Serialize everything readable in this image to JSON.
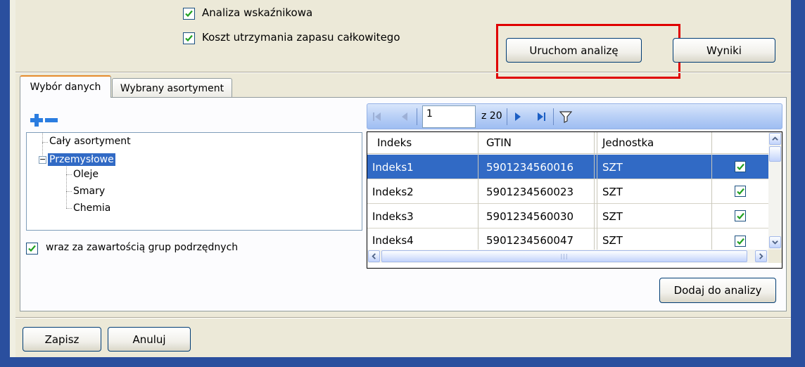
{
  "options": {
    "ratio_analysis": {
      "label": "Analiza wskaźnikowa",
      "checked": true
    },
    "inventory_cost": {
      "label": "Koszt utrzymania zapasu całkowitego",
      "checked": true
    }
  },
  "buttons": {
    "run_analysis": "Uruchom analizę",
    "results": "Wyniki",
    "add_to_analysis": "Dodaj do analizy",
    "save": "Zapisz",
    "cancel": "Anuluj"
  },
  "tabs": [
    {
      "label": "Wybór danych",
      "active": true
    },
    {
      "label": "Wybrany asortyment",
      "active": false
    }
  ],
  "tree": {
    "root": "Cały asortyment",
    "group": "Przemysłowe",
    "children": [
      "Oleje",
      "Smary",
      "Chemia"
    ]
  },
  "include_subgroups": {
    "label": "wraz za zawartością grup podrzędnych",
    "checked": true
  },
  "pager": {
    "page": "1",
    "total_label": "z 20"
  },
  "grid": {
    "columns": [
      "Indeks",
      "GTIN",
      "Jednostka"
    ],
    "rows": [
      {
        "index": "Indeks1",
        "gtin": "5901234560016",
        "unit": "SZT",
        "checked": true,
        "selected": true
      },
      {
        "index": "Indeks2",
        "gtin": "5901234560023",
        "unit": "SZT",
        "checked": true,
        "selected": false
      },
      {
        "index": "Indeks3",
        "gtin": "5901234560030",
        "unit": "SZT",
        "checked": true,
        "selected": false
      },
      {
        "index": "Indeks4",
        "gtin": "5901234560047",
        "unit": "SZT",
        "checked": true,
        "selected": false
      }
    ]
  },
  "colors": {
    "window_frame": "#2a4f9e",
    "dialog_bg": "#ece9d8",
    "selection": "#316ac5",
    "highlight_box": "#e00000",
    "expand_blue": "#2b7de0"
  }
}
